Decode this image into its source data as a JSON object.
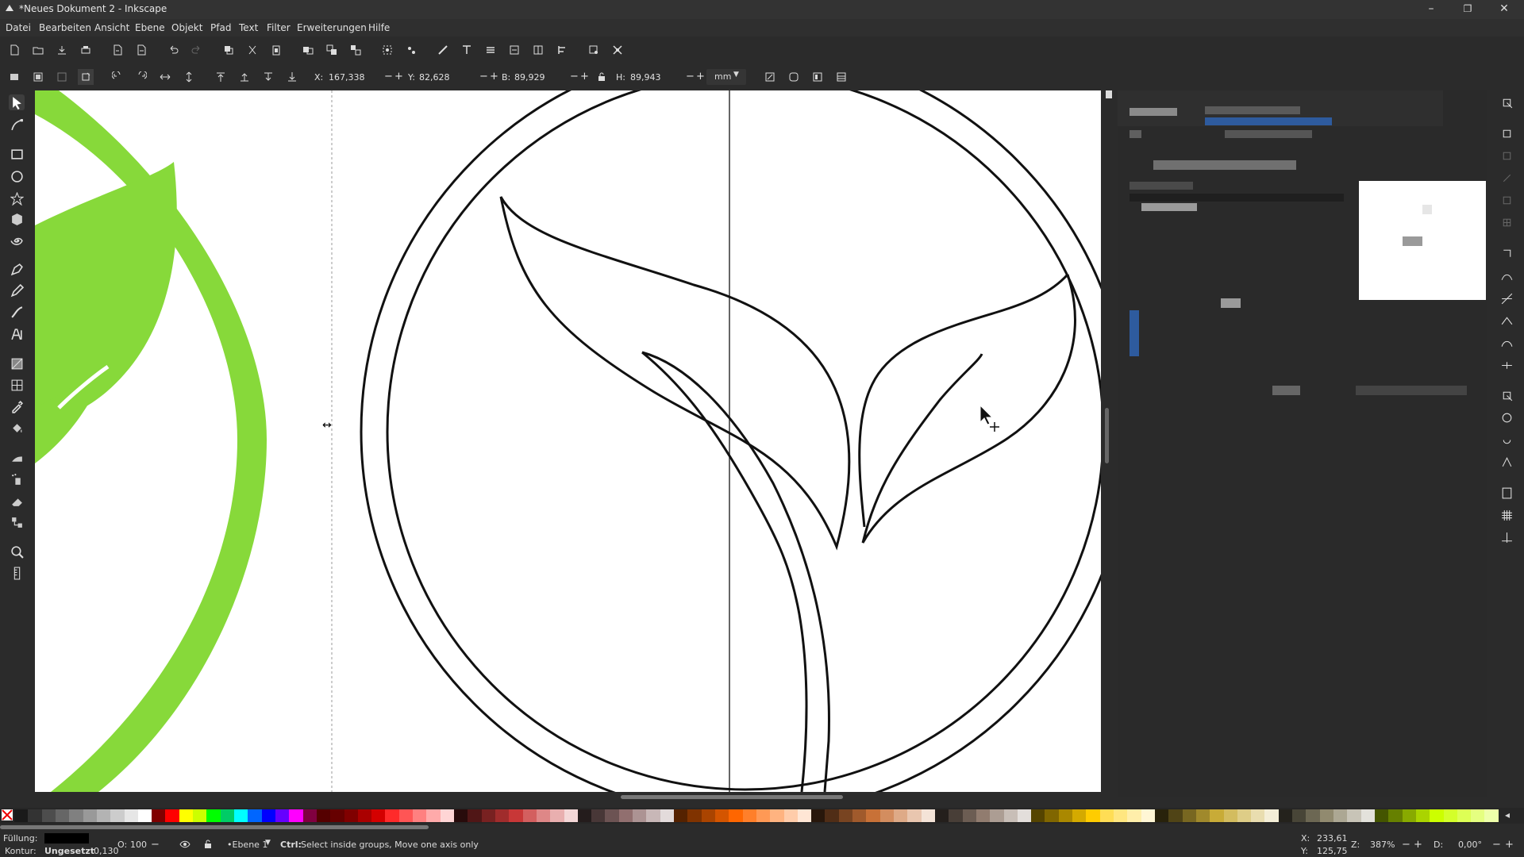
{
  "window": {
    "title": "*Neues Dokument 2 - Inkscape",
    "controls": {
      "minimize": "–",
      "maximize": "❐",
      "close": "✕"
    }
  },
  "menu": [
    "Datei",
    "Bearbeiten",
    "Ansicht",
    "Ebene",
    "Objekt",
    "Pfad",
    "Text",
    "Filter",
    "Erweiterungen",
    "Hilfe"
  ],
  "tool_controls": {
    "x_label": "X:",
    "x_value": "167,338",
    "y_label": "Y:",
    "y_value": "82,628",
    "w_label": "B:",
    "w_value": "89,929",
    "h_label": "H:",
    "h_value": "89,943",
    "unit": "mm",
    "minus": "−",
    "plus": "+"
  },
  "statusbar": {
    "fill_label": "Füllung:",
    "stroke_label": "Kontur:",
    "stroke_value": "Ungesetzt",
    "stroke_width": "0,130",
    "opacity_label": "O:",
    "opacity_value": "100",
    "layer": "•Ebene 1",
    "message_bold": "Ctrl:",
    "message": "Select inside groups, Move one axis only",
    "cursor_x_label": "X:",
    "cursor_x": "233,61",
    "cursor_y_label": "Y:",
    "cursor_y": "125,75",
    "zoom_label": "Z:",
    "zoom": "387%",
    "rotate_label": "D:",
    "rotate": "0,00°",
    "minus": "−",
    "plus": "+"
  },
  "colors": {
    "logo_green": "#87d93a",
    "canvas": "#ffffff",
    "ui_bg": "#2b2b2b",
    "accent_blue": "#2e5b9e",
    "fill_swatch": "#000000"
  },
  "palette": [
    "#1a1a1a",
    "#333333",
    "#4d4d4d",
    "#666666",
    "#808080",
    "#999999",
    "#b3b3b3",
    "#cccccc",
    "#e6e6e6",
    "#ffffff",
    "#800000",
    "#ff0000",
    "#ffff00",
    "#ccff00",
    "#00ff00",
    "#00cc66",
    "#00ffff",
    "#0066ff",
    "#0000ff",
    "#6600ff",
    "#ff00ff",
    "#800040",
    "#550000",
    "#660000",
    "#800000",
    "#aa0000",
    "#d40000",
    "#ff2a2a",
    "#ff5555",
    "#ff8080",
    "#ffaaaa",
    "#ffd5d5",
    "#280b0b",
    "#501616",
    "#782121",
    "#a02c2c",
    "#c83737",
    "#d35f5f",
    "#de8787",
    "#e9afaf",
    "#f4d7d7",
    "#241c1c",
    "#483737",
    "#6c5353",
    "#916f6f",
    "#ac9393",
    "#c8b7b7",
    "#e3dbdb",
    "#552200",
    "#803300",
    "#aa4400",
    "#d45500",
    "#ff6600",
    "#ff7f2a",
    "#ff9955",
    "#ffb380",
    "#ffccaa",
    "#ffe6d5",
    "#28170b",
    "#502d16",
    "#784421",
    "#a05a2c",
    "#c87137",
    "#d38d5f",
    "#deaa87",
    "#e9c6af",
    "#f4e3d7",
    "#241f1c",
    "#483e37",
    "#6c5d53",
    "#917c6f",
    "#ac9d93",
    "#c8beb7",
    "#e3dedb",
    "#554400",
    "#806600",
    "#aa8800",
    "#d4aa00",
    "#ffcc00",
    "#ffdd55",
    "#ffe680",
    "#ffeeaa",
    "#fff6d5",
    "#28220b",
    "#504416",
    "#786721",
    "#a0892c",
    "#c8ab37",
    "#d3bc5f",
    "#decd87",
    "#e9ddaf",
    "#f4eed7",
    "#24221c",
    "#484537",
    "#6c6753",
    "#918a6f",
    "#aca793",
    "#c8c4b7",
    "#e3e2db",
    "#445500",
    "#668000",
    "#88aa00",
    "#aad400",
    "#ccff00",
    "#d4ff2a",
    "#ddff55",
    "#e5ff80",
    "#eeffaa"
  ]
}
